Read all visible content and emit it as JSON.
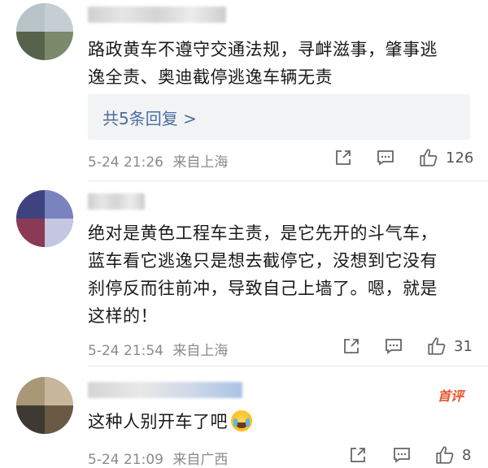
{
  "comments": [
    {
      "text_lines": [
        "路政黄车不遵守交通法规，寻衅滋事，肇事逃",
        "逸全责、奥迪截停逃逸车辆无责"
      ],
      "replies_label": "共5条回复 >",
      "date": "5-24 21:26",
      "location": "来自上海",
      "likes": "126",
      "avatar_colors": [
        "#9fb0bf",
        "#7d8f6a",
        "#b7c4cc",
        "#5f6f4f"
      ]
    },
    {
      "text_lines": [
        "绝对是黄色工程车主责，是它先开的斗气车，",
        "蓝车看它逃逸只是想去截停它，没想到它没有",
        "刹停反而往前冲，导致自己上墙了。嗯，就是",
        "这样的！"
      ],
      "date": "5-24 21:54",
      "location": "来自上海",
      "likes": "31",
      "avatar_colors": [
        "#4a4f8a",
        "#8a3a4a",
        "#6f79b5",
        "#c9c9e0"
      ]
    },
    {
      "text": "这种人别开车了吧",
      "badge": "首评",
      "date": "5-24 21:09",
      "location": "来自广西",
      "likes": "8",
      "avatar_colors": [
        "#8a7a63",
        "#5a4a3a",
        "#c8b79a",
        "#3e3a33"
      ]
    }
  ],
  "icons": {
    "share": "share-icon",
    "reply": "comment-icon",
    "like": "thumbs-up-icon",
    "emoji": "crying-laughing-emoji-icon"
  },
  "colors": {
    "link": "#4a6d9c",
    "meta": "#8a8a8a",
    "badge": "#e8552d",
    "reply_bg": "#f2f3f5"
  }
}
